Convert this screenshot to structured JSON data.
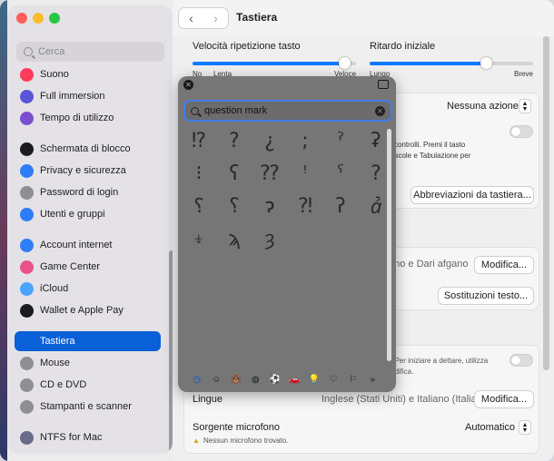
{
  "sidebar": {
    "search_placeholder": "Cerca",
    "items": [
      {
        "label": "Suono",
        "icon": "speaker-icon",
        "color": "#ff3b5c"
      },
      {
        "label": "Full immersion",
        "icon": "moon-icon",
        "color": "#5856d6"
      },
      {
        "label": "Tempo di utilizzo",
        "icon": "hourglass-icon",
        "color": "#7a4fd0"
      },
      {
        "label": "Schermata di blocco",
        "icon": "lock-screen-icon",
        "color": "#1c1c1e"
      },
      {
        "label": "Privacy e sicurezza",
        "icon": "hand-icon",
        "color": "#2f7df6"
      },
      {
        "label": "Password di login",
        "icon": "lock-icon",
        "color": "#8e8e93"
      },
      {
        "label": "Utenti e gruppi",
        "icon": "users-icon",
        "color": "#2f7df6"
      },
      {
        "label": "Account internet",
        "icon": "at-icon",
        "color": "#2f7df6"
      },
      {
        "label": "Game Center",
        "icon": "game-center-icon",
        "color": "#e8528a"
      },
      {
        "label": "iCloud",
        "icon": "cloud-icon",
        "color": "#4aa3ff"
      },
      {
        "label": "Wallet e Apple Pay",
        "icon": "wallet-icon",
        "color": "#1c1c1e"
      },
      {
        "label": "Tastiera",
        "icon": "keyboard-icon",
        "color": "#0a60d6"
      },
      {
        "label": "Mouse",
        "icon": "mouse-icon",
        "color": "#8e8e93"
      },
      {
        "label": "CD e DVD",
        "icon": "disc-icon",
        "color": "#8e8e93"
      },
      {
        "label": "Stampanti e scanner",
        "icon": "printer-icon",
        "color": "#8e8e93"
      },
      {
        "label": "NTFS for Mac",
        "icon": "ntfs-icon",
        "color": "#6a6a8a"
      }
    ]
  },
  "toolbar": {
    "title": "Tastiera",
    "back": "‹",
    "forward": "›"
  },
  "settings": {
    "repeat_rate_label": "Velocità ripetizione tasto",
    "repeat_rate_min": "No",
    "repeat_rate_slow": "Lenta",
    "repeat_rate_fast": "Veloce",
    "repeat_rate_value": 0.93,
    "delay_label": "Ritardo iniziale",
    "delay_min": "Lungo",
    "delay_max": "Breve",
    "delay_value": 0.71,
    "fn_action_value": "Nessuna azione",
    "nav_text_1": "i controlli. Premi il tasto",
    "nav_text_2": "uscole e Tabulazione per",
    "shortcuts_button": "Abbreviazioni da tastiera...",
    "input_sources_value": "ano e Dari afgano",
    "modify_button_1": "Modifica...",
    "replacements_button": "Sostituzioni testo...",
    "dictation_text_1": ". Per iniziare a dettare, utilizza",
    "dictation_text_2": "odifica.",
    "languages_label": "Lingue",
    "languages_value": "Inglese (Stati Uniti) e Italiano (Italia)",
    "modify_button_2": "Modifica...",
    "mic_label": "Sorgente microfono",
    "mic_value": "Automatico",
    "mic_warning": "Nessun microfono trovato."
  },
  "palette": {
    "search_value": "question mark",
    "glyphs": [
      "⁉",
      "?",
      "¿",
      ";",
      "ˀ",
      "ʡ",
      "⁝",
      "ʕ",
      "⁇",
      "ꜝ",
      "ˁ",
      "?",
      "؟",
      "⸮",
      "ɂ",
      "⁈",
      "ʔ",
      "ꞻ",
      "⍖",
      "ϡ",
      "ȝ"
    ],
    "categories": [
      "clock-icon",
      "smiley-icon",
      "bear-icon",
      "apple-icon",
      "ball-icon",
      "car-icon",
      "bulb-icon",
      "heart-icon",
      "flag-icon",
      "more-icon"
    ],
    "category_glyphs": [
      "◷",
      "☺",
      "🐻",
      "◍",
      "⚽",
      "🚗",
      "💡",
      "♡",
      "⚐",
      "»"
    ]
  }
}
